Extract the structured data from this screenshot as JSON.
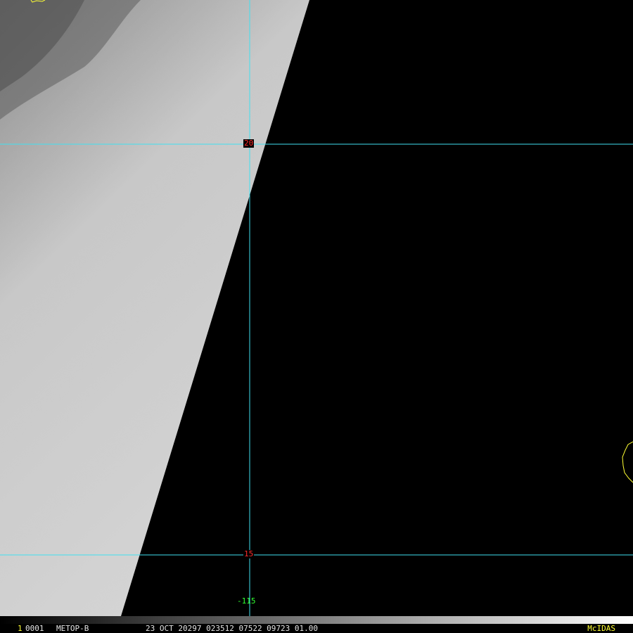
{
  "image": {
    "satellite": "METOP-B",
    "frame_number": "1",
    "frame_id": "0001",
    "datetime_line": "23 OCT 20297 023512 07522 09723 01.00",
    "brand": "McIDAS"
  },
  "grid": {
    "lat_labels": [
      "20",
      "15"
    ],
    "lon_labels": [
      "-115"
    ],
    "line_color": "#40e0f0",
    "lat_label_color": "#ff2a2a",
    "lon_label_color": "#32ff32"
  },
  "overlay": {
    "coastline_color": "#ffff33"
  }
}
